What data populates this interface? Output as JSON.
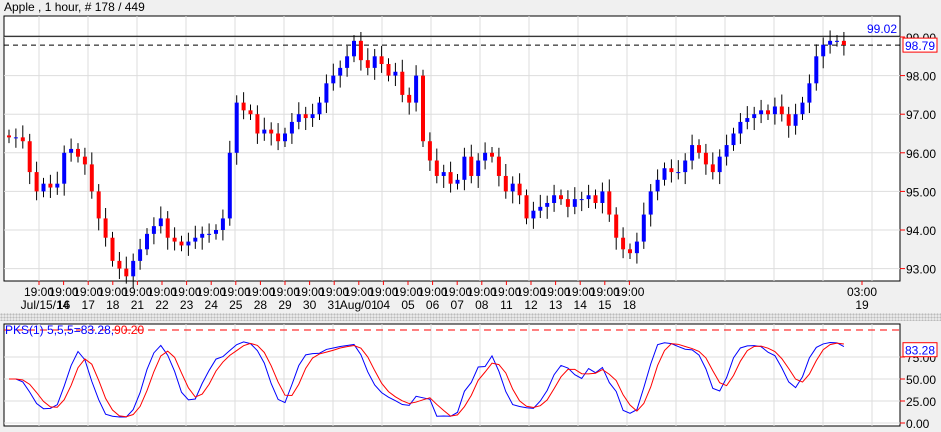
{
  "title": "Apple , 1 hour, # 178 / 449",
  "colors": {
    "up": "#0000ff",
    "down": "#ff0000",
    "grid": "#dddddd"
  },
  "price_axis": {
    "ticks": [
      "99.00",
      "98.00",
      "97.00",
      "96.00",
      "95.00",
      "94.00",
      "93.00"
    ],
    "high_line": "99.02",
    "last_price": "98.79"
  },
  "time_axis": {
    "times": [
      "19:00",
      "19:00",
      "19:00",
      "19:00",
      "19:00",
      "19:00",
      "19:00",
      "19:00",
      "19:00",
      "19:00",
      "19:00",
      "19:00",
      "19:00",
      "19:00",
      "19:00",
      "19:00",
      "19:00",
      "19:00",
      "19:00",
      "19:00",
      "19:00",
      "19:00",
      "19:00",
      "19:00",
      "19:00",
      "03:00"
    ],
    "dates": [
      "Jul/15/14",
      "16",
      "17",
      "18",
      "21",
      "22",
      "23",
      "24",
      "25",
      "28",
      "29",
      "30",
      "31",
      "Aug/01",
      "04",
      "05",
      "06",
      "07",
      "08",
      "11",
      "12",
      "13",
      "14",
      "15",
      "18",
      "19"
    ]
  },
  "indicator": {
    "label_name": "PKS(1)",
    "label_params": " 5,5,5=83.28,",
    "label_value2": "90.20",
    "ticks": [
      "75.00",
      "50.00",
      "25.00",
      "0.00"
    ],
    "last_value": "83.28"
  },
  "chart_data": {
    "type": "candlestick",
    "ylim": [
      92.3,
      99.6
    ],
    "closes": [
      96.4,
      96.4,
      96.3,
      95.5,
      95.0,
      95.2,
      95.1,
      95.2,
      96.0,
      96.1,
      95.9,
      95.7,
      95.0,
      94.3,
      93.8,
      93.2,
      93.0,
      92.8,
      93.2,
      93.5,
      93.9,
      94.1,
      94.3,
      93.8,
      93.7,
      93.6,
      93.7,
      93.8,
      93.9,
      93.9,
      94.0,
      94.3,
      96.0,
      97.3,
      97.1,
      97.0,
      96.5,
      96.6,
      96.5,
      96.3,
      96.5,
      96.8,
      97.0,
      96.9,
      97.0,
      97.3,
      97.8,
      98.0,
      98.2,
      98.5,
      98.9,
      98.4,
      98.2,
      98.5,
      98.3,
      98.0,
      98.1,
      97.5,
      97.3,
      98.0,
      96.3,
      95.8,
      95.4,
      95.5,
      95.2,
      95.3,
      95.9,
      95.4,
      95.8,
      96.0,
      95.9,
      95.4,
      95.0,
      95.2,
      94.9,
      94.3,
      94.5,
      94.6,
      94.7,
      94.9,
      94.8,
      94.6,
      94.8,
      94.8,
      94.9,
      94.7,
      95.0,
      94.4,
      93.8,
      93.5,
      93.4,
      93.7,
      94.4,
      95.0,
      95.3,
      95.6,
      95.5,
      95.5,
      95.8,
      96.2,
      96.0,
      95.7,
      95.5,
      95.9,
      96.2,
      96.5,
      96.8,
      96.9,
      97.0,
      97.1,
      97.0,
      97.2,
      97.0,
      96.7,
      97.0,
      97.3,
      97.8,
      98.5,
      98.8,
      98.9,
      98.9,
      98.79
    ]
  }
}
